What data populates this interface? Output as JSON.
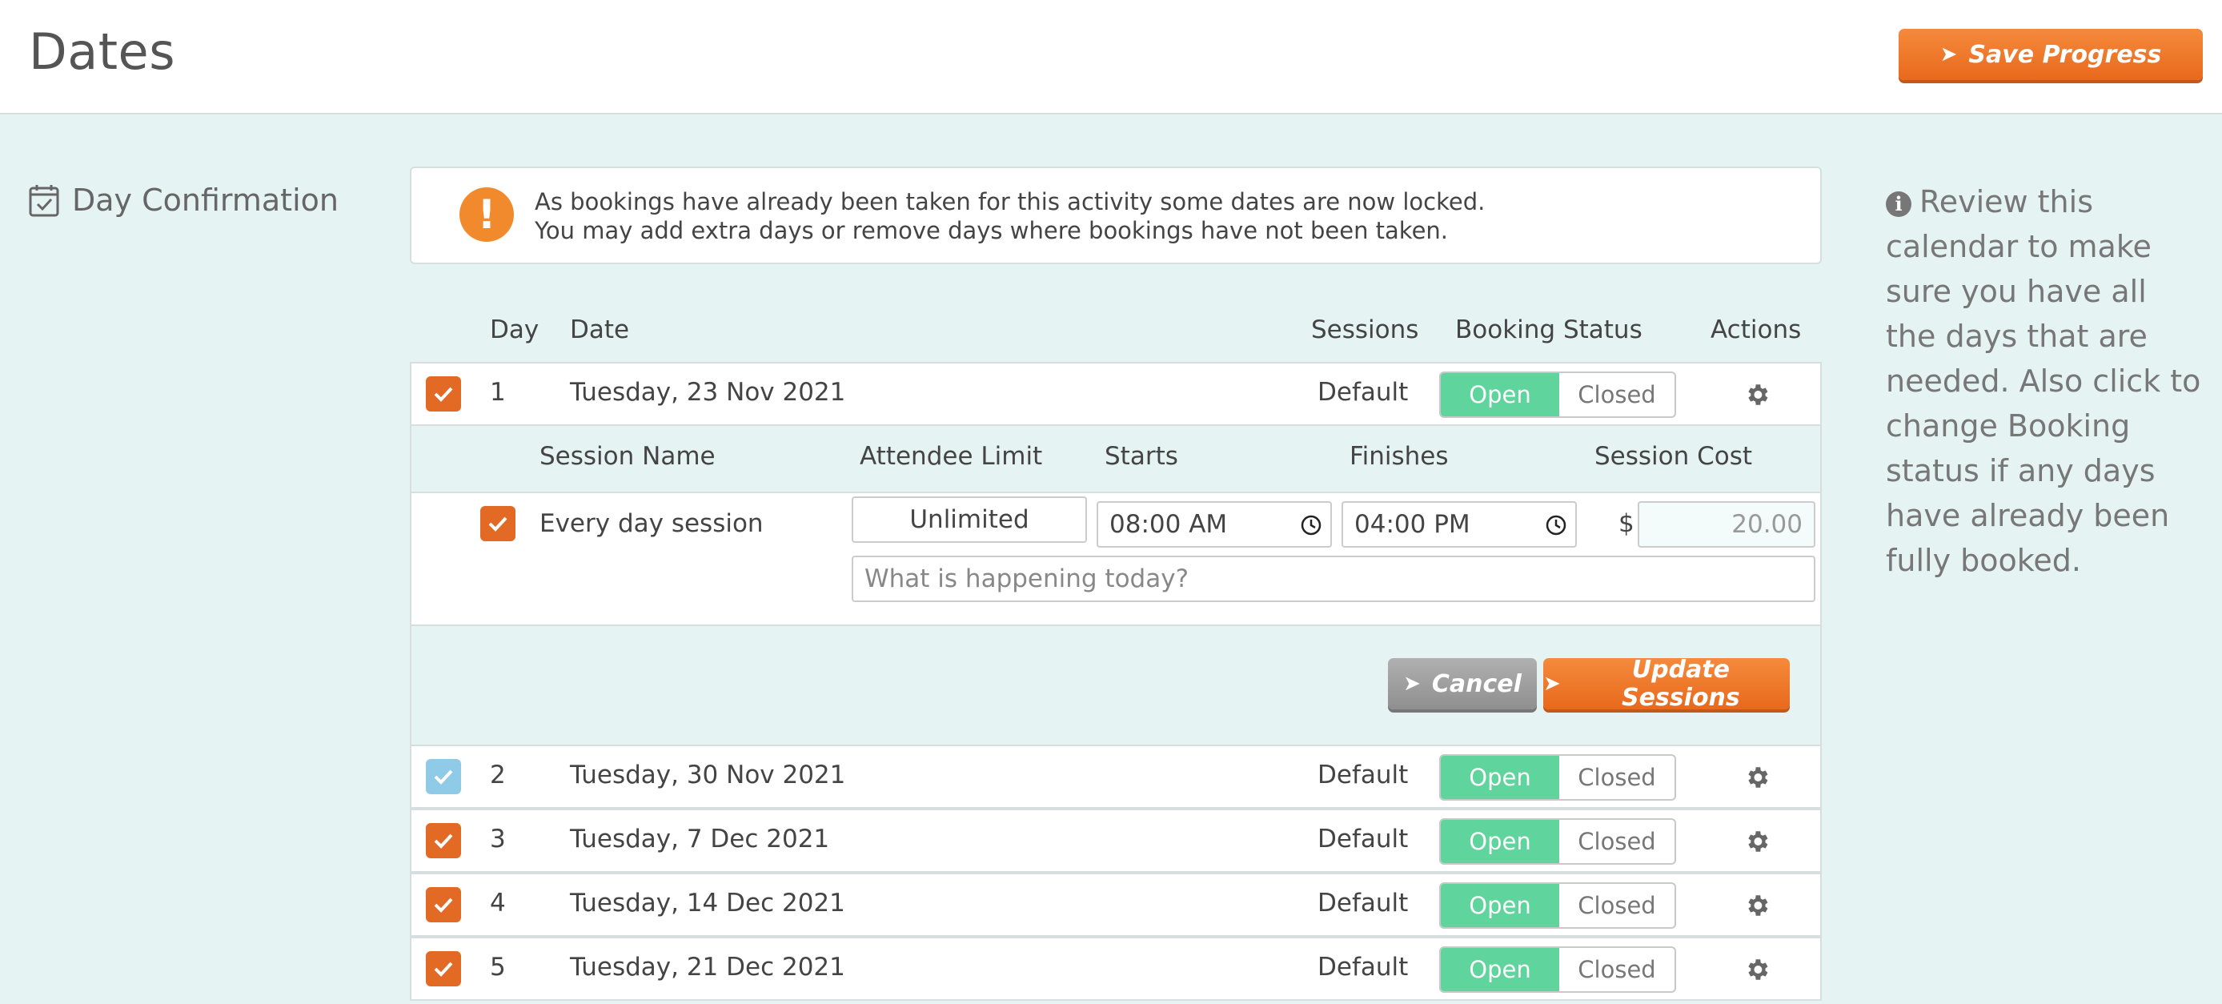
{
  "header": {
    "title": "Dates",
    "save_label": "Save Progress"
  },
  "section": {
    "title": "Day Confirmation"
  },
  "alert": {
    "line1": "As bookings have already been taken for this activity some dates are now locked.",
    "line2": "You may add extra days or remove days where bookings have not been taken."
  },
  "columns": {
    "day": "Day",
    "date": "Date",
    "sessions": "Sessions",
    "status": "Booking Status",
    "actions": "Actions"
  },
  "days": [
    {
      "day": "1",
      "date": "Tuesday, 23 Nov 2021",
      "sessions": "Default",
      "open": "Open",
      "closed": "Closed"
    },
    {
      "day": "2",
      "date": "Tuesday, 30 Nov 2021",
      "sessions": "Default",
      "open": "Open",
      "closed": "Closed"
    },
    {
      "day": "3",
      "date": "Tuesday, 7 Dec 2021",
      "sessions": "Default",
      "open": "Open",
      "closed": "Closed"
    },
    {
      "day": "4",
      "date": "Tuesday, 14 Dec 2021",
      "sessions": "Default",
      "open": "Open",
      "closed": "Closed"
    },
    {
      "day": "5",
      "date": "Tuesday, 21 Dec 2021",
      "sessions": "Default",
      "open": "Open",
      "closed": "Closed"
    }
  ],
  "session_columns": {
    "name": "Session Name",
    "limit": "Attendee Limit",
    "starts": "Starts",
    "finishes": "Finishes",
    "cost": "Session Cost"
  },
  "session": {
    "name": "Every day session",
    "limit": "Unlimited",
    "starts": "08:00 AM",
    "finishes": "04:00 PM",
    "currency": "$",
    "cost": "20.00",
    "description_placeholder": "What is happening today?"
  },
  "buttons": {
    "cancel": "Cancel",
    "update": "Update Sessions"
  },
  "side_note": "Review this calendar to make sure you have all the days that are needed. Also click to change Booking status if any days have already been fully booked.",
  "colors": {
    "accent": "#e8691c",
    "open": "#5fd49d",
    "background": "#e5f3f2"
  }
}
